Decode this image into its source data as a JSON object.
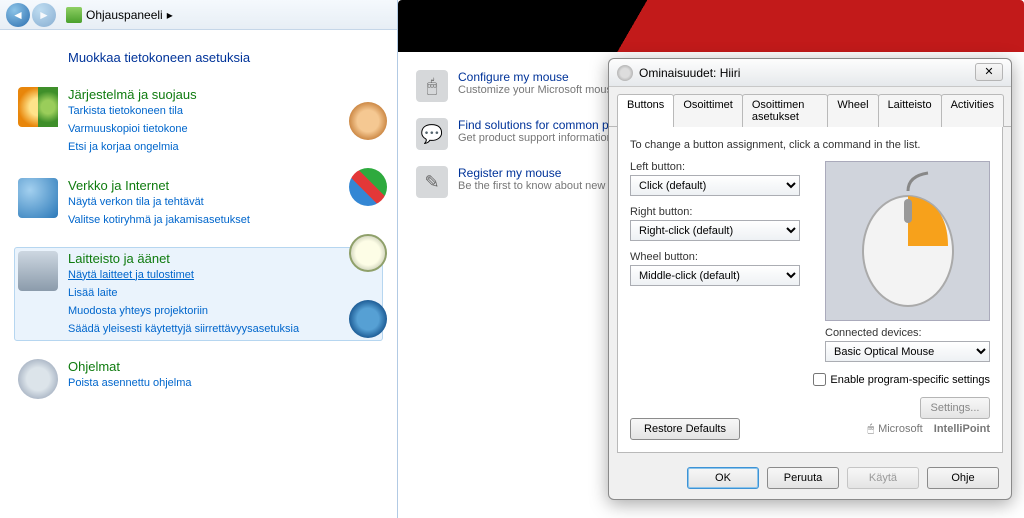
{
  "cp": {
    "breadcrumb": "Ohjauspaneeli",
    "breadcrumb_sep": "▸",
    "heading": "Muokkaa tietokoneen asetuksia",
    "cats": [
      {
        "title": "Järjestelmä ja suojaus",
        "links": [
          "Tarkista tietokoneen tila",
          "Varmuuskopioi tietokone",
          "Etsi ja korjaa ongelmia"
        ]
      },
      {
        "title": "Verkko ja Internet",
        "links": [
          "Näytä verkon tila ja tehtävät",
          "Valitse kotiryhmä ja jakamisasetukset"
        ]
      },
      {
        "title": "Laitteisto ja äänet",
        "links": [
          "Näytä laitteet ja tulostimet",
          "Lisää laite",
          "Muodosta yhteys projektoriin",
          "Säädä yleisesti käytettyjä siirrettävyysasetuksia"
        ]
      },
      {
        "title": "Ohjelmat",
        "links": [
          "Poista asennettu ohjelma"
        ]
      }
    ]
  },
  "mouseapp": {
    "items": [
      {
        "title": "Configure my mouse",
        "sub": "Customize your Microsoft mouse"
      },
      {
        "title": "Find solutions for common proble",
        "sub": "Get product support information"
      },
      {
        "title": "Register my mouse",
        "sub": "Be the first to know about new pro"
      }
    ]
  },
  "dialog": {
    "title": "Ominaisuudet: Hiiri",
    "close": "✕",
    "tabs": [
      "Buttons",
      "Osoittimet",
      "Osoittimen asetukset",
      "Wheel",
      "Laitteisto",
      "Activities"
    ],
    "help": "To change a button assignment, click a command in the list.",
    "left_label": "Left button:",
    "left_value": "Click (default)",
    "right_label": "Right button:",
    "right_value": "Right-click (default)",
    "wheel_label": "Wheel button:",
    "wheel_value": "Middle-click (default)",
    "connected_label": "Connected devices:",
    "connected_value": "Basic Optical Mouse",
    "enable_chk": "Enable program-specific settings",
    "settings_btn": "Settings...",
    "restore_btn": "Restore Defaults",
    "brand": "Microsoft",
    "brand2": "IntelliPoint",
    "ok": "OK",
    "cancel": "Peruuta",
    "apply": "Käytä",
    "helpbtn": "Ohje"
  }
}
